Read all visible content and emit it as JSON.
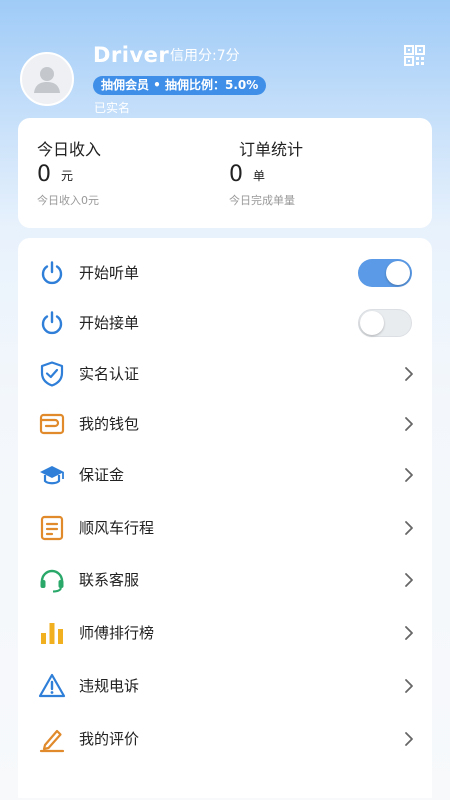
{
  "profile": {
    "name": "Driver",
    "credit": "信用分:7分",
    "badge": "抽佣会员 • 抽佣比例：5.0%",
    "verified": "已实名"
  },
  "stats": {
    "income": {
      "title": "今日收入",
      "value": "0",
      "unit": "元",
      "sub": "今日收入0元"
    },
    "orders": {
      "title": "订单统计",
      "value": "0",
      "unit": "单",
      "sub": "今日完成单量"
    }
  },
  "menu": {
    "items": [
      {
        "label": "开始听单",
        "icon": "power-icon",
        "control": "toggle",
        "on": true
      },
      {
        "label": "开始接单",
        "icon": "power-icon",
        "control": "toggle",
        "on": false
      },
      {
        "label": "实名认证",
        "icon": "shield-check-icon",
        "control": "chevron"
      },
      {
        "label": "我的钱包",
        "icon": "wallet-icon",
        "control": "chevron"
      },
      {
        "label": "保证金",
        "icon": "graduation-cap-icon",
        "control": "chevron"
      },
      {
        "label": "顺风车行程",
        "icon": "document-icon",
        "control": "chevron"
      },
      {
        "label": "联系客服",
        "icon": "headset-icon",
        "control": "chevron"
      },
      {
        "label": "师傅排行榜",
        "icon": "bar-chart-icon",
        "control": "chevron"
      },
      {
        "label": "违规电诉",
        "icon": "warning-icon",
        "control": "chevron"
      },
      {
        "label": "我的评价",
        "icon": "edit-icon",
        "control": "chevron"
      }
    ]
  },
  "colors": {
    "accent_blue": "#2f7fd8",
    "accent_orange": "#e08a2b",
    "accent_green": "#2aa86a",
    "accent_yellow": "#f0b020",
    "toggle_on": "#5a9ae6"
  }
}
